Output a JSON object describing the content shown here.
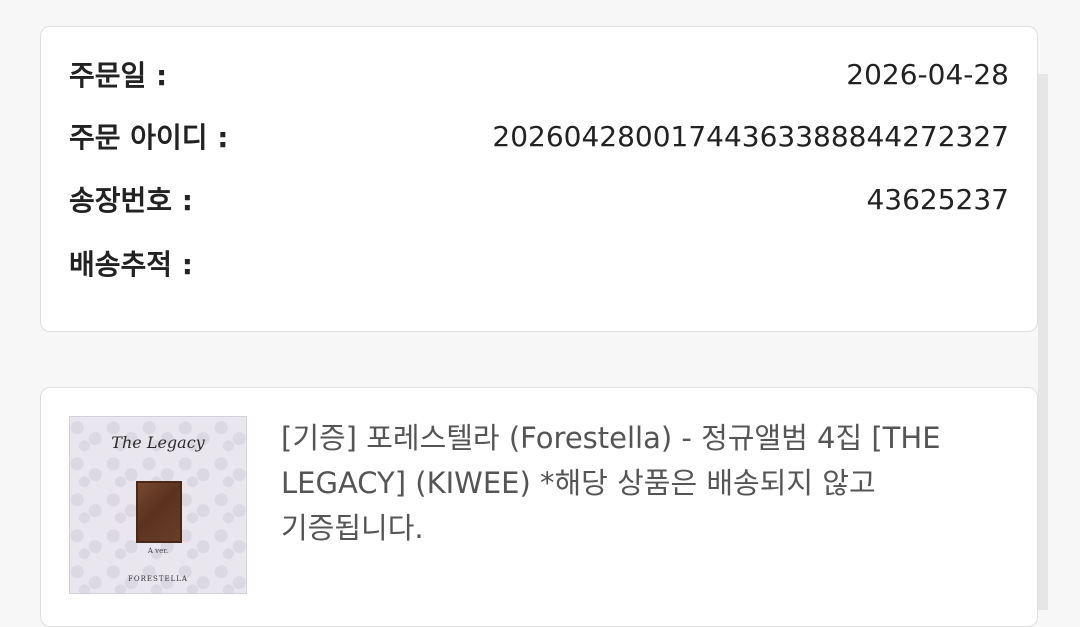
{
  "order": {
    "date_label": "주문일 :",
    "date_value": "2026-04-28",
    "id_label": "주문 아이디 :",
    "id_value": "20260428001744363388844272327",
    "invoice_label": "송장번호 :",
    "invoice_value": "43625237",
    "tracking_label": "배송추적 :"
  },
  "product": {
    "album_title": "The Legacy",
    "album_version": "A ver.",
    "album_artist": "FORESTELLA",
    "name": "[기증] 포레스텔라 (Forestella) - 정규앨범 4집 [THE LEGACY] (KIWEE) *해당 상품은 배송되지 않고 기증됩니다."
  }
}
